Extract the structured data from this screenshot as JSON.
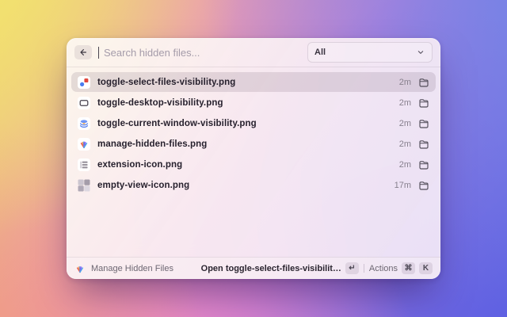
{
  "header": {
    "search_placeholder": "Search hidden files...",
    "filter_dropdown": {
      "value": "All"
    }
  },
  "list": {
    "selected_index": 0,
    "items": [
      {
        "icon": "select-files",
        "name": "toggle-select-files-visibility.png",
        "time": "2m"
      },
      {
        "icon": "desktop-window",
        "name": "toggle-desktop-visibility.png",
        "time": "2m"
      },
      {
        "icon": "window-stack",
        "name": "toggle-current-window-visibility.png",
        "time": "2m"
      },
      {
        "icon": "hidden-files-burst",
        "name": "manage-hidden-files.png",
        "time": "2m"
      },
      {
        "icon": "extension-grid",
        "name": "extension-icon.png",
        "time": "2m"
      },
      {
        "icon": "checkerboard",
        "name": "empty-view-icon.png",
        "time": "17m"
      }
    ]
  },
  "footer": {
    "app_name": "Manage Hidden Files",
    "primary_action_label": "Open toggle-select-files-visibilit…",
    "primary_action_key": "↵",
    "actions_label": "Actions",
    "actions_keys": [
      "⌘",
      "K"
    ]
  },
  "colors": {
    "bg_top_left": "#f2e46e",
    "bg_top_right": "#6f86e8",
    "bg_bottom_left": "#f0997f",
    "bg_bottom_right": "#5a5ee2",
    "selection_highlight": "rgba(73,44,73,0.13)"
  }
}
